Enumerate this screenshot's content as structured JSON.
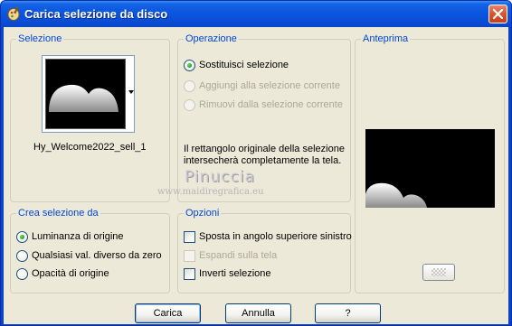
{
  "window": {
    "title": "Carica selezione da disco",
    "icons": {
      "app": "paint-palette-icon",
      "close": "close-icon"
    }
  },
  "selezione": {
    "label": "Selezione",
    "filename": "Hy_Welcome2022_sell_1"
  },
  "operazione": {
    "label": "Operazione",
    "options": [
      {
        "label": "Sostituisci selezione",
        "selected": true,
        "enabled": true
      },
      {
        "label": "Aggiungi alla selezione corrente",
        "selected": false,
        "enabled": false
      },
      {
        "label": "Rimuovi dalla selezione corrente",
        "selected": false,
        "enabled": false
      }
    ],
    "description": "Il rettangolo originale della selezione intersecherà completamente la tela."
  },
  "anteprima": {
    "label": "Anteprima"
  },
  "crea": {
    "label": "Crea selezione da",
    "options": [
      {
        "label": "Luminanza di origine",
        "selected": true
      },
      {
        "label": "Qualsiasi val. diverso da zero",
        "selected": false
      },
      {
        "label": "Opacità di origine",
        "selected": false
      }
    ]
  },
  "opzioni": {
    "label": "Opzioni",
    "options": [
      {
        "label": "Sposta in angolo superiore sinistro",
        "checked": false,
        "enabled": true
      },
      {
        "label": "Espandi sulla tela",
        "checked": false,
        "enabled": false
      },
      {
        "label": "Inverti selezione",
        "checked": false,
        "enabled": true
      }
    ]
  },
  "buttons": {
    "load": "Carica",
    "cancel": "Annulla",
    "help": "?"
  },
  "watermark": {
    "name": "Pinuccia",
    "url": "www.maidiregrafica.eu"
  },
  "colors": {
    "title_blue": "#0a4dd6",
    "group_label": "#0046d5",
    "dialog_bg": "#ece9d8",
    "radio_selected": "#21a121"
  }
}
